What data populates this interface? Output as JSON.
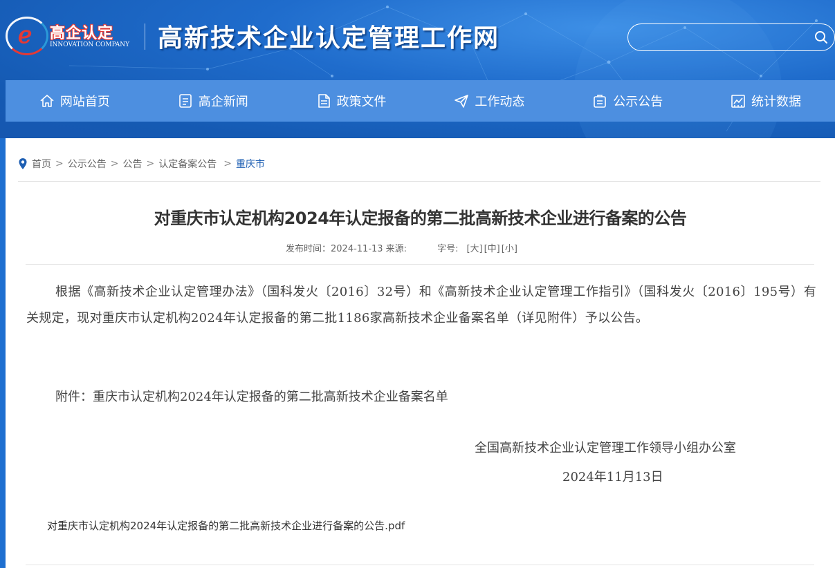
{
  "header": {
    "logo_cn": "高企认定",
    "logo_en": "INNOVATION COMPANY",
    "site_title": "高新技术企业认定管理工作网",
    "search_placeholder": ""
  },
  "nav": {
    "items": [
      {
        "label": "网站首页",
        "icon": "home-icon"
      },
      {
        "label": "高企新闻",
        "icon": "news-icon"
      },
      {
        "label": "政策文件",
        "icon": "document-icon"
      },
      {
        "label": "工作动态",
        "icon": "paper-plane-icon"
      },
      {
        "label": "公示公告",
        "icon": "notice-icon"
      },
      {
        "label": "统计数据",
        "icon": "chart-icon"
      }
    ]
  },
  "breadcrumb": {
    "items": [
      "首页",
      "公示公告",
      "公告",
      "认定备案公告"
    ],
    "current": "重庆市"
  },
  "article": {
    "title": "对重庆市认定机构2024年认定报备的第二批高新技术企业进行备案的公告",
    "meta_publish": "发布时间：2024-11-13 来源:",
    "meta_fontsize_label": "字号:",
    "size_large": "[大]",
    "size_medium": "[中]",
    "size_small": "[小]",
    "body": "根据《高新技术企业认定管理办法》（国科发火〔2016〕32号）和《高新技术企业认定管理工作指引》（国科发火〔2016〕195号）有关规定，现对重庆市认定机构2024年认定报备的第二批1186家高新技术企业备案名单（详见附件）予以公告。",
    "attachment_label": "附件：重庆市认定机构2024年认定报备的第二批高新技术企业备案名单",
    "signer": "全国高新技术企业认定管理工作领导小组办公室",
    "sign_date": "2024年11月13日",
    "attachment_file": "对重庆市认定机构2024年认定报备的第二批高新技术企业进行备案的公告.pdf"
  },
  "colors": {
    "header_blue": "#1f6ccc",
    "nav_blue": "#4d8fe0",
    "breadcrumb_current": "#1e5fb3",
    "logo_red": "#e53935"
  }
}
